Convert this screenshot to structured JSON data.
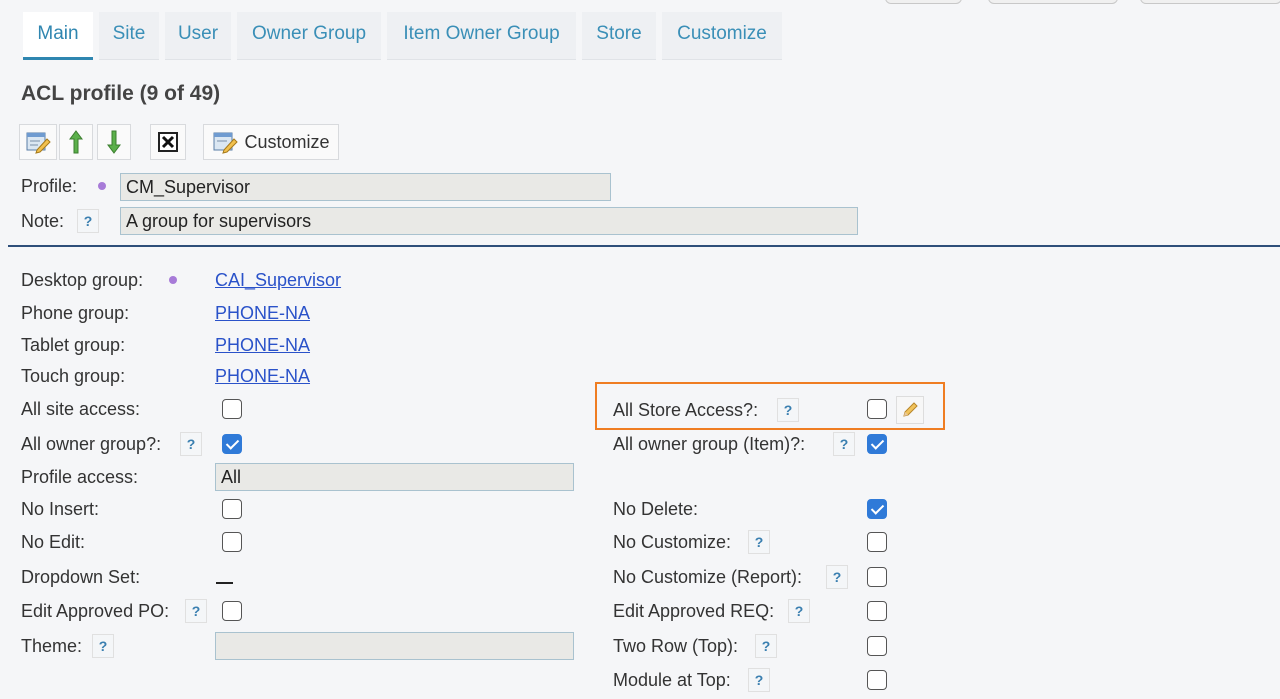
{
  "tabs": [
    "Main",
    "Site",
    "User",
    "Owner Group",
    "Item Owner Group",
    "Store",
    "Customize"
  ],
  "page_title": "ACL profile (9 of 49)",
  "toolbar": {
    "customize_label": "Customize",
    "icons": [
      "edit-icon",
      "arrow-up-icon",
      "arrow-down-icon",
      "close-box-icon",
      "customize-icon"
    ]
  },
  "profile": {
    "label": "Profile:",
    "value": "CM_Supervisor"
  },
  "note": {
    "label": "Note:",
    "value": "A group for supervisors"
  },
  "help_glyph": "?",
  "left_fields": {
    "desktop_group": {
      "label": "Desktop group:",
      "value": "CAI_Supervisor"
    },
    "phone_group": {
      "label": "Phone group:",
      "value": "PHONE-NA"
    },
    "tablet_group": {
      "label": "Tablet group:",
      "value": "PHONE-NA"
    },
    "touch_group": {
      "label": "Touch group:",
      "value": "PHONE-NA"
    },
    "all_site_access": {
      "label": "All site access:",
      "checked": false
    },
    "all_owner_group": {
      "label": "All owner group?:",
      "checked": true
    },
    "profile_access": {
      "label": "Profile access:",
      "value": "All"
    },
    "no_insert": {
      "label": "No Insert:",
      "checked": false
    },
    "no_edit": {
      "label": "No Edit:",
      "checked": false
    },
    "dropdown_set": {
      "label": "Dropdown Set:",
      "value": ""
    },
    "edit_approved_po": {
      "label": "Edit Approved PO:",
      "checked": false
    },
    "theme": {
      "label": "Theme:",
      "value": ""
    }
  },
  "right_fields": {
    "all_store_access": {
      "label": "All Store Access?:",
      "checked": false
    },
    "all_owner_group_item": {
      "label": "All owner group (Item)?:",
      "checked": true
    },
    "no_delete": {
      "label": "No Delete:",
      "checked": true
    },
    "no_customize": {
      "label": "No Customize:",
      "checked": false
    },
    "no_customize_report": {
      "label": "No Customize (Report):",
      "checked": false
    },
    "edit_approved_req": {
      "label": "Edit Approved REQ:",
      "checked": false
    },
    "two_row_top": {
      "label": "Two Row (Top):",
      "checked": false
    },
    "module_at_top": {
      "label": "Module at Top:",
      "checked": false
    }
  },
  "colors": {
    "tab_text": "#3a8fb7",
    "link": "#2a52c9",
    "checkbox_checked": "#2f7ad8",
    "highlight": "#ef7d22",
    "divider": "#2e4f7a"
  }
}
